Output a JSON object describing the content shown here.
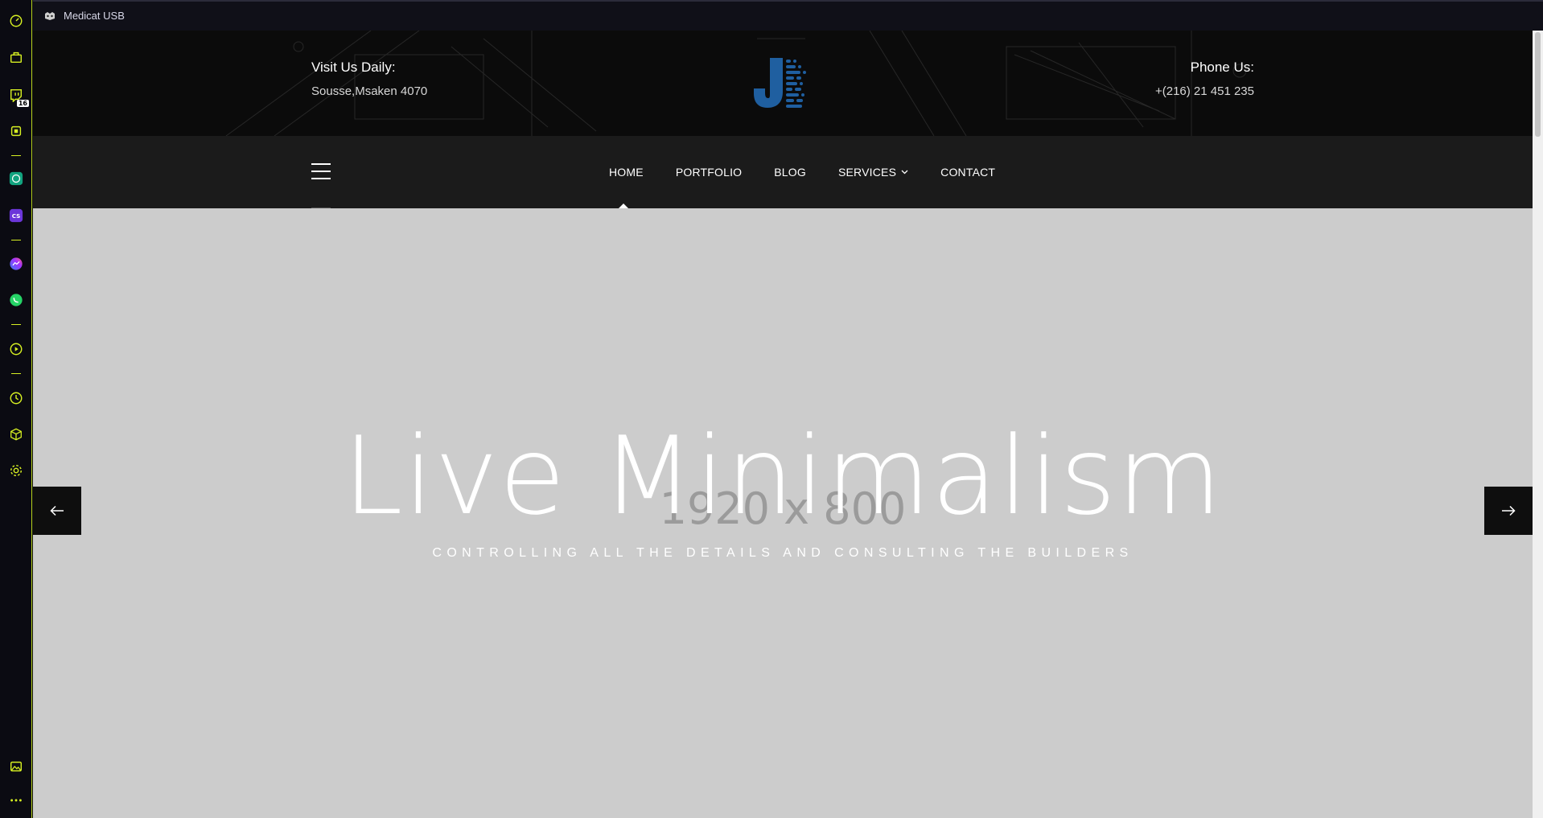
{
  "window": {
    "title": "Medicat USB"
  },
  "sidebar": {
    "items": [
      {
        "icon": "speedometer-icon"
      },
      {
        "icon": "bag-icon"
      },
      {
        "icon": "twitch-icon",
        "badge": "16"
      },
      {
        "icon": "chip-icon"
      },
      {
        "icon": "chatgpt-icon"
      },
      {
        "icon": "cs-app-icon"
      },
      {
        "icon": "messenger-icon"
      },
      {
        "icon": "whatsapp-icon"
      },
      {
        "icon": "play-icon"
      },
      {
        "icon": "clock-icon"
      },
      {
        "icon": "cube-icon"
      },
      {
        "icon": "settings-icon"
      },
      {
        "icon": "gallery-icon"
      },
      {
        "icon": "more-icon"
      }
    ],
    "accent_color": "#d6ef22"
  },
  "topbar": {
    "visit_label": "Visit Us Daily:",
    "visit_value": "Sousse,Msaken 4070",
    "phone_label": "Phone Us:",
    "phone_value": "+(216) 21 451 235",
    "logo_color": "#1f5fa0"
  },
  "nav": {
    "items": [
      {
        "label": "HOME",
        "active": true
      },
      {
        "label": "PORTFOLIO"
      },
      {
        "label": "BLOG"
      },
      {
        "label": "SERVICES",
        "has_dropdown": true
      },
      {
        "label": "CONTACT"
      }
    ]
  },
  "hero": {
    "placeholder_dims": "1920 x 800",
    "title": "Live Minimalism",
    "subtitle": "CONTROLLING ALL THE DETAILS AND CONSULTING THE BUILDERS",
    "prev_icon": "arrow-left-icon",
    "next_icon": "arrow-right-icon",
    "background": "#cccccc"
  }
}
